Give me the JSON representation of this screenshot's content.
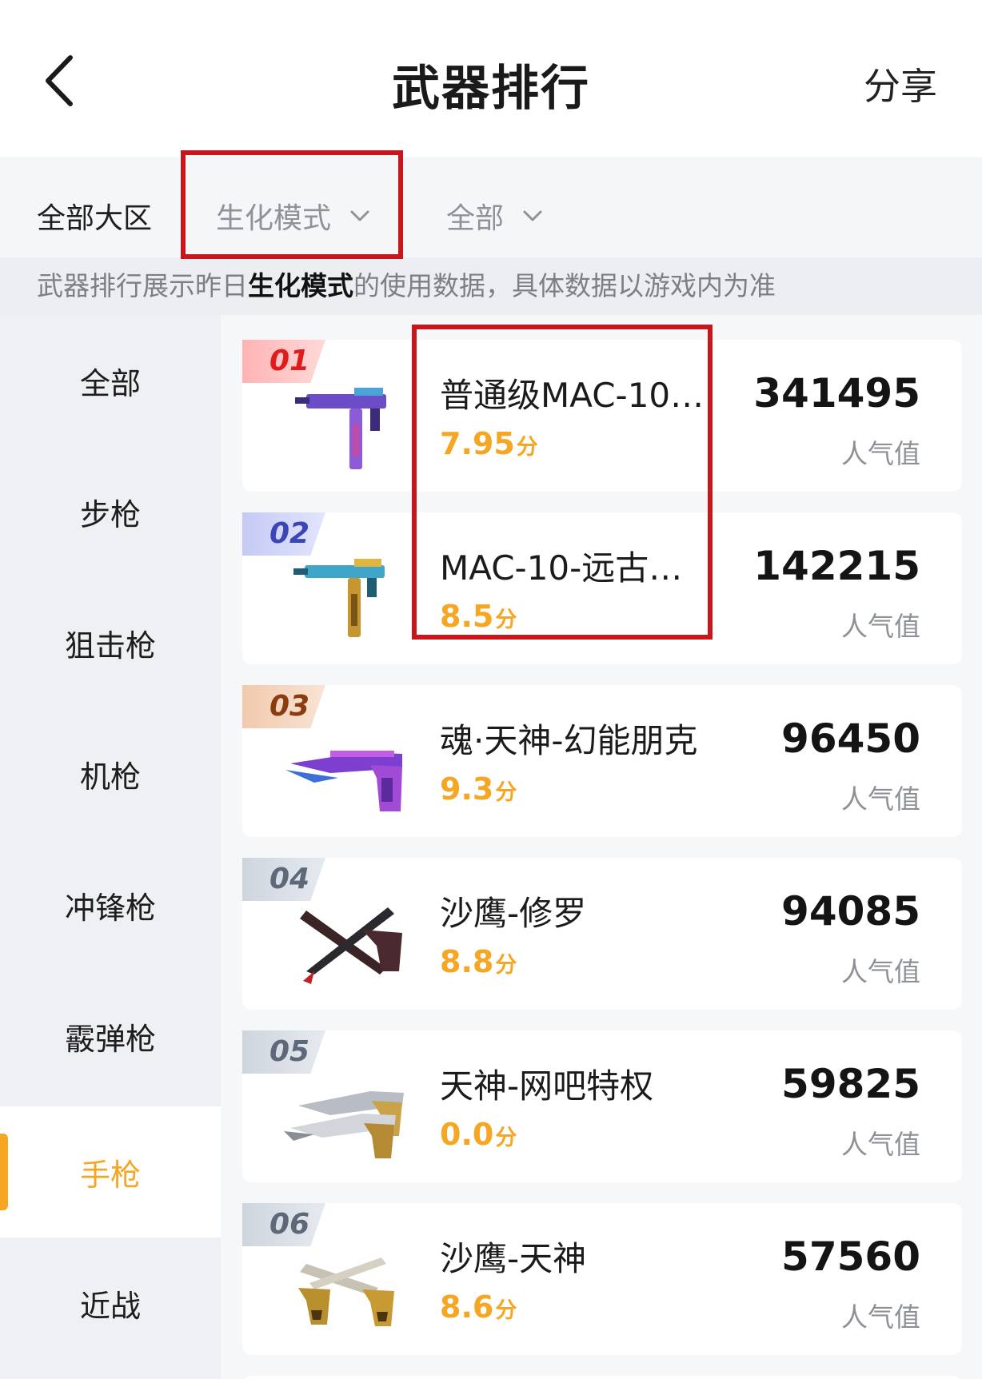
{
  "header": {
    "title": "武器排行",
    "share_label": "分享"
  },
  "filters": {
    "region": "全部大区",
    "mode": "生化模式",
    "scope": "全部"
  },
  "notice": {
    "prefix": "武器排行展示昨日",
    "highlight": "生化模式",
    "suffix": "的使用数据，具体数据以游戏内为准"
  },
  "sidebar": {
    "items": [
      {
        "label": "全部"
      },
      {
        "label": "步枪"
      },
      {
        "label": "狙击枪"
      },
      {
        "label": "机枪"
      },
      {
        "label": "冲锋枪"
      },
      {
        "label": "霰弹枪"
      },
      {
        "label": "手枪"
      },
      {
        "label": "近战"
      }
    ],
    "active": "手枪"
  },
  "list": {
    "score_unit": "分",
    "popularity_label": "人气值",
    "items": [
      {
        "rank": "01",
        "name": "普通级MAC-10…",
        "score": "7.95",
        "popularity": "341495",
        "icon": "mac10-purple-icon"
      },
      {
        "rank": "02",
        "name": "MAC-10-远古…",
        "score": "8.5",
        "popularity": "142215",
        "icon": "mac10-gold-icon"
      },
      {
        "rank": "03",
        "name": "魂·天神-幻能朋克",
        "score": "9.3",
        "popularity": "96450",
        "icon": "desert-eagle-purple-icon"
      },
      {
        "rank": "04",
        "name": "沙鹰-修罗",
        "score": "8.8",
        "popularity": "94085",
        "icon": "desert-eagle-dark-icon"
      },
      {
        "rank": "05",
        "name": "天神-网吧特权",
        "score": "0.0",
        "popularity": "59825",
        "icon": "dual-pistol-silver-icon"
      },
      {
        "rank": "06",
        "name": "沙鹰-天神",
        "score": "8.6",
        "popularity": "57560",
        "icon": "dual-pistol-gold-icon"
      }
    ]
  },
  "colors": {
    "accent": "#f5a623",
    "highlight_box": "#c8161d"
  }
}
